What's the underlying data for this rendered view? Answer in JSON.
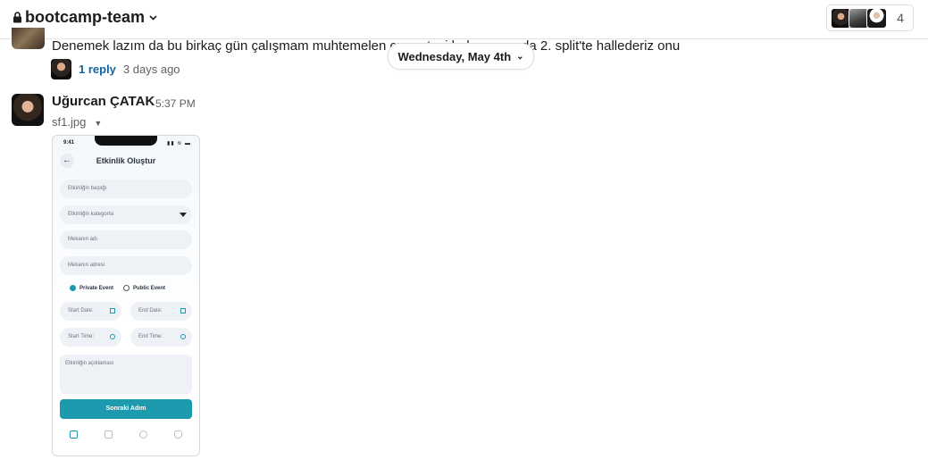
{
  "header": {
    "channel_name": "bootcamp-team",
    "member_count": "4"
  },
  "prev_message": {
    "text": "Denemek lazım da bu birkaç gün çalışmam muhtemelen cumartesi bakarım ya da 2. split'te hallederiz onu",
    "reply_label": "1 reply",
    "reply_time": "3 days ago"
  },
  "date_divider": {
    "label": "Wednesday, May 4th"
  },
  "message": {
    "author": "Uğurcan ÇATAK",
    "time": "5:37 PM",
    "file_name": "sf1.jpg"
  },
  "phone_preview": {
    "status_time": "9:41",
    "title": "Etkinlik Oluştur",
    "fields": {
      "title": "Etkinliğin başlığı",
      "category": "Etkinliğin kategorisi",
      "venue_name": "Mekanın adı",
      "venue_address": "Mekanın adresi"
    },
    "radio_private": "Private Event",
    "radio_public": "Public Event",
    "start_date": "Start Date:",
    "end_date": "End Date:",
    "start_time": "Start Time:",
    "end_time": "End Time:",
    "description": "Etkinliğin açıklaması",
    "next_button": "Sonraki Adım"
  },
  "colors": {
    "link": "#1264a3",
    "accent": "#1d9aae"
  }
}
